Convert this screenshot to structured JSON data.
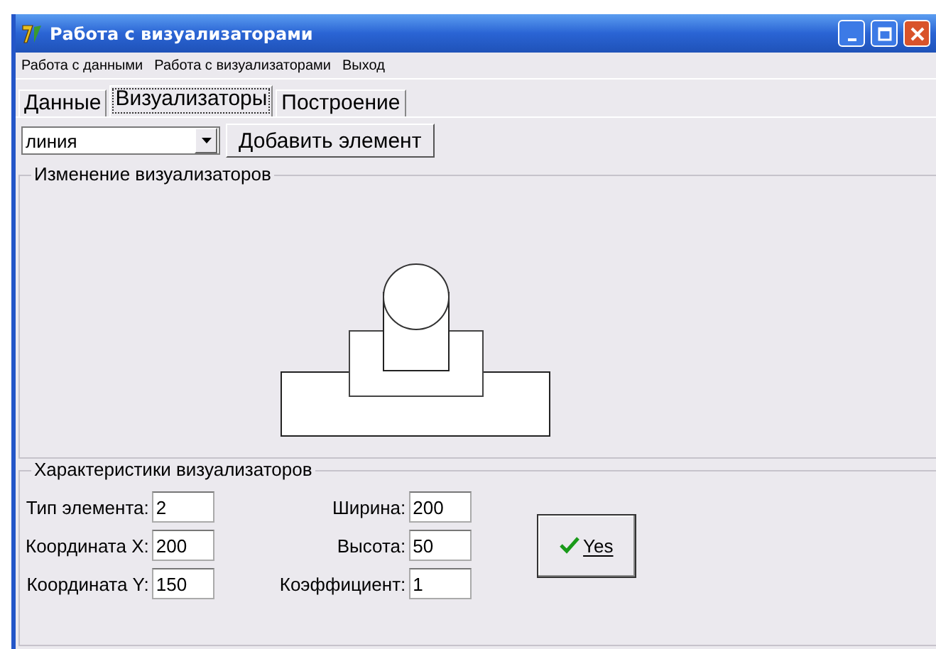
{
  "window": {
    "title": "Работа с визуализаторами"
  },
  "menu": [
    "Работа с данными",
    "Работа с визуализаторами",
    "Выход"
  ],
  "tabs": [
    {
      "label": "Данные",
      "selected": false
    },
    {
      "label": "Визуализаторы",
      "selected": true
    },
    {
      "label": "Построение",
      "selected": false
    }
  ],
  "element_select": {
    "value": "линия"
  },
  "add_button": "Добавить элемент",
  "preview_group": {
    "title": "Изменение визуализаторов"
  },
  "properties_group": {
    "title": "Характеристики визуализаторов",
    "left_fields": [
      {
        "label": "Тип элемента:",
        "value": "2"
      },
      {
        "label": "Координата X:",
        "value": "200"
      },
      {
        "label": "Координата Y:",
        "value": "150"
      }
    ],
    "right_fields": [
      {
        "label": "Ширина:",
        "value": "200"
      },
      {
        "label": "Высота:",
        "value": "50"
      },
      {
        "label": "Коэффициент:",
        "value": "1"
      }
    ],
    "confirm_button": "Yes"
  }
}
